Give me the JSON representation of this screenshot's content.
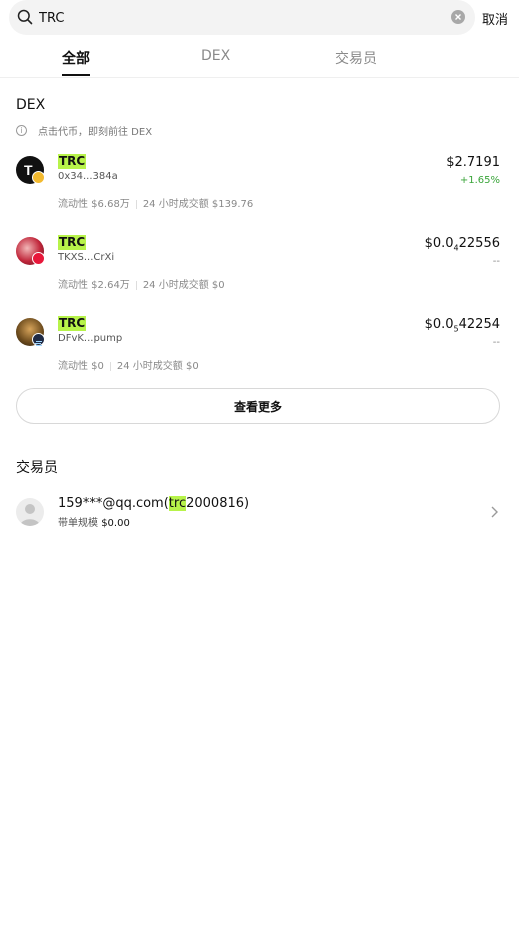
{
  "search": {
    "value": "TRC",
    "cancel_label": "取消"
  },
  "tabs": [
    {
      "label": "全部",
      "active": true
    },
    {
      "label": "DEX",
      "active": false
    },
    {
      "label": "交易员",
      "active": false
    }
  ],
  "dex": {
    "title": "DEX",
    "hint": "点击代币，即刻前往 DEX",
    "tokens": [
      {
        "symbol": "TRC",
        "address": "0x34...384a",
        "liquidity": "流动性 $6.68万",
        "volume": "24 小时成交额 $139.76",
        "price": "$2.7191",
        "change": "+1.65%",
        "change_color": "#3aa53a",
        "avatar_icon": "tron-t-icon",
        "chain_icon": "bnb-chain-icon"
      },
      {
        "symbol": "TRC",
        "address": "TKXS...CrXi",
        "liquidity": "流动性 $2.64万",
        "volume": "24 小时成交额 $0",
        "price_main": "$0.0",
        "price_sub": "4",
        "price_tail": "22556",
        "change": "--",
        "change_color": "#888888",
        "avatar_icon": "team-photo-icon",
        "chain_icon": "tron-chain-icon"
      },
      {
        "symbol": "TRC",
        "address": "DFvK...pump",
        "liquidity": "流动性 $0",
        "volume": "24 小时成交额 $0",
        "price_main": "$0.0",
        "price_sub": "5",
        "price_tail": "42254",
        "change": "--",
        "change_color": "#888888",
        "avatar_icon": "character-portrait-icon",
        "chain_icon": "solana-chain-icon"
      }
    ],
    "more_label": "查看更多"
  },
  "traders": {
    "title": "交易员",
    "items": [
      {
        "name_prefix": "159***@qq.com(",
        "name_highlight": "trc",
        "name_suffix": "2000816)",
        "meta_label": "带单规模",
        "meta_value": "$0.00"
      }
    ]
  },
  "colors": {
    "highlight": "#b7f34a",
    "positive": "#3aa53a"
  }
}
